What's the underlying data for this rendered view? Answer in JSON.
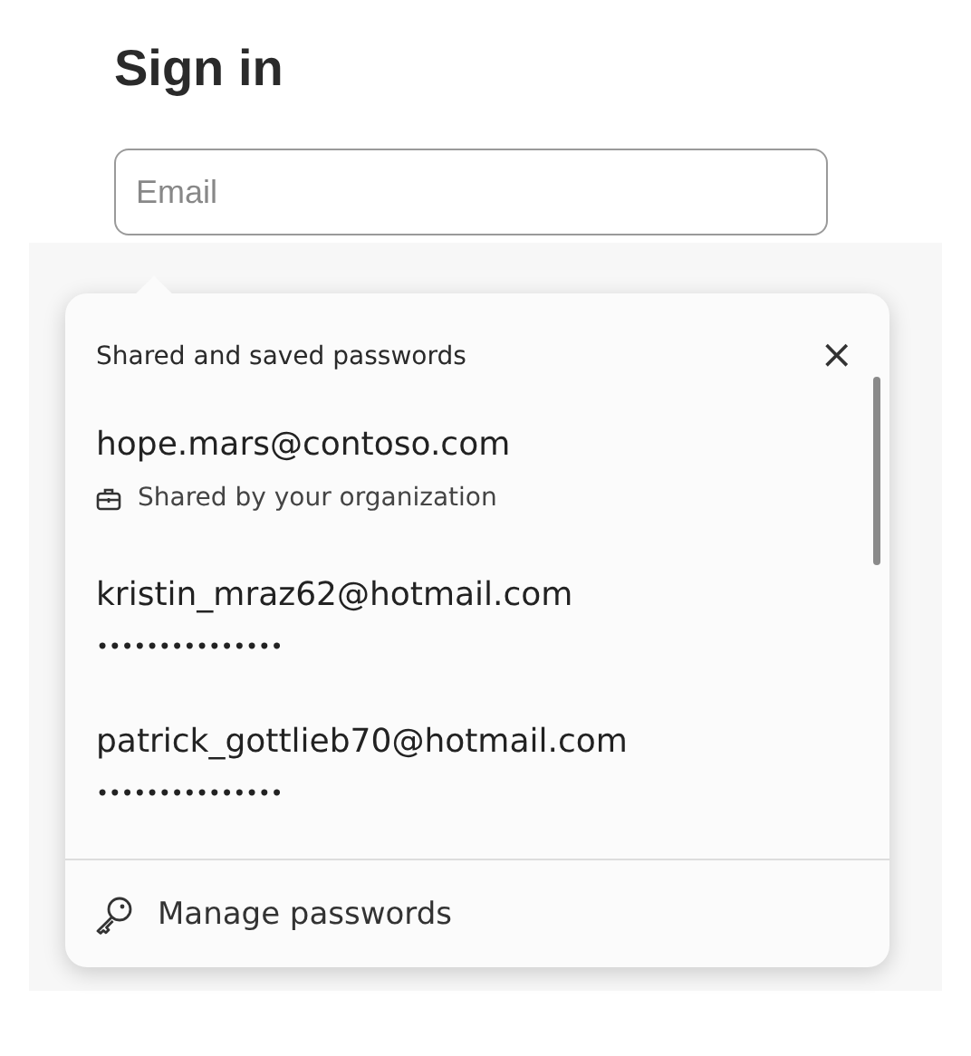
{
  "title": "Sign in",
  "email_field": {
    "placeholder": "Email"
  },
  "popup": {
    "heading": "Shared and saved passwords",
    "close": "×",
    "entries": [
      {
        "kind": "shared",
        "account": "hope.mars@contoso.com",
        "detail": "Shared by your organization"
      },
      {
        "kind": "saved",
        "account": "kristin_mraz62@hotmail.com",
        "detail": "•••••••••••••••"
      },
      {
        "kind": "saved",
        "account": "patrick_gottlieb70@hotmail.com",
        "detail": "•••••••••••••••"
      }
    ],
    "footer": "Manage passwords"
  }
}
